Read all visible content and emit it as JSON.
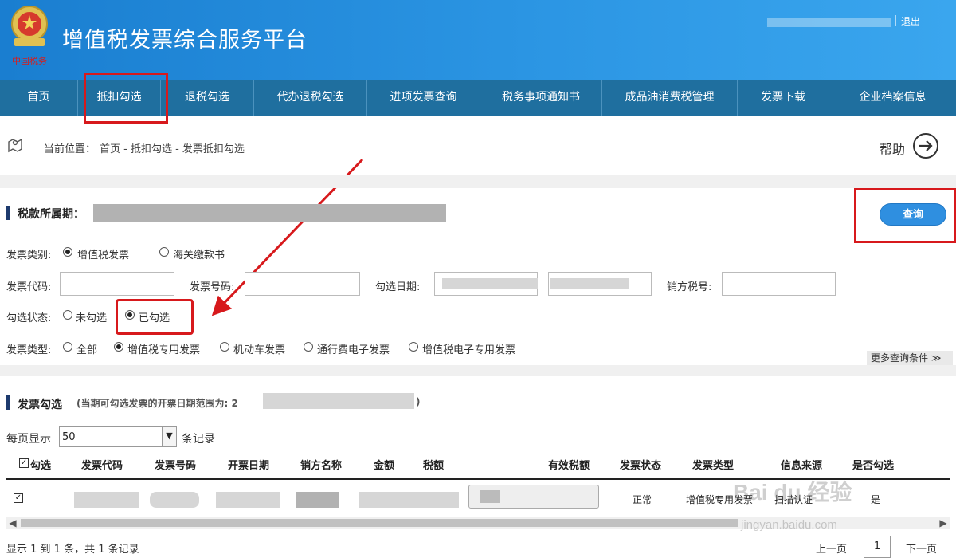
{
  "header": {
    "title": "增值税发票综合服务平台",
    "logo_caption": "中国税务",
    "logout": "退出"
  },
  "nav": {
    "items": [
      {
        "label": "首页"
      },
      {
        "label": "抵扣勾选"
      },
      {
        "label": "退税勾选"
      },
      {
        "label": "代办退税勾选"
      },
      {
        "label": "进项发票查询"
      },
      {
        "label": "税务事项通知书"
      },
      {
        "label": "成品油消费税管理"
      },
      {
        "label": "发票下载"
      },
      {
        "label": "企业档案信息"
      }
    ]
  },
  "breadcrumb": {
    "label": "当前位置：",
    "path": "首页 - 抵扣勾选 - 发票抵扣勾选",
    "help": "帮助"
  },
  "query_section": {
    "period_label": "税款所属期：",
    "query_button": "查询",
    "invoice_category_label": "发票类别:",
    "invoice_category_options": [
      "增值税发票",
      "海关缴款书"
    ],
    "invoice_category_selected": "增值税发票",
    "invoice_code_label": "发票代码:",
    "invoice_number_label": "发票号码:",
    "check_date_label": "勾选日期:",
    "seller_tax_id_label": "销方税号:",
    "check_status_label": "勾选状态:",
    "check_status_options": [
      "未勾选",
      "已勾选"
    ],
    "check_status_selected": "已勾选",
    "invoice_type_label": "发票类型:",
    "invoice_type_options": [
      "全部",
      "增值税专用发票",
      "机动车发票",
      "通行费电子发票",
      "增值税电子专用发票"
    ],
    "invoice_type_selected": "增值税专用发票",
    "more_conditions": "更多查询条件"
  },
  "result_section": {
    "title": "发票勾选",
    "subtitle": "(当期可勾选发票的开票日期范围为: 2",
    "subtitle_end": ")",
    "per_page_label": "每页显示",
    "per_page_value": "50",
    "per_page_suffix": "条记录",
    "columns": [
      "勾选",
      "发票代码",
      "发票号码",
      "开票日期",
      "销方名称",
      "金额",
      "税额",
      "有效税额",
      "发票状态",
      "发票类型",
      "信息来源",
      "是否勾选"
    ],
    "rows": [
      {
        "checked": true,
        "status": "正常",
        "type": "增值税专用发票",
        "source": "扫描认证",
        "is_checked": "是"
      }
    ]
  },
  "pager": {
    "info": "显示 1 到 1 条，共 1 条记录",
    "prev": "上一页",
    "page": "1",
    "next": "下一页"
  },
  "watermark": {
    "brand": "Bai du 经验",
    "url": "jingyan.baidu.com"
  }
}
